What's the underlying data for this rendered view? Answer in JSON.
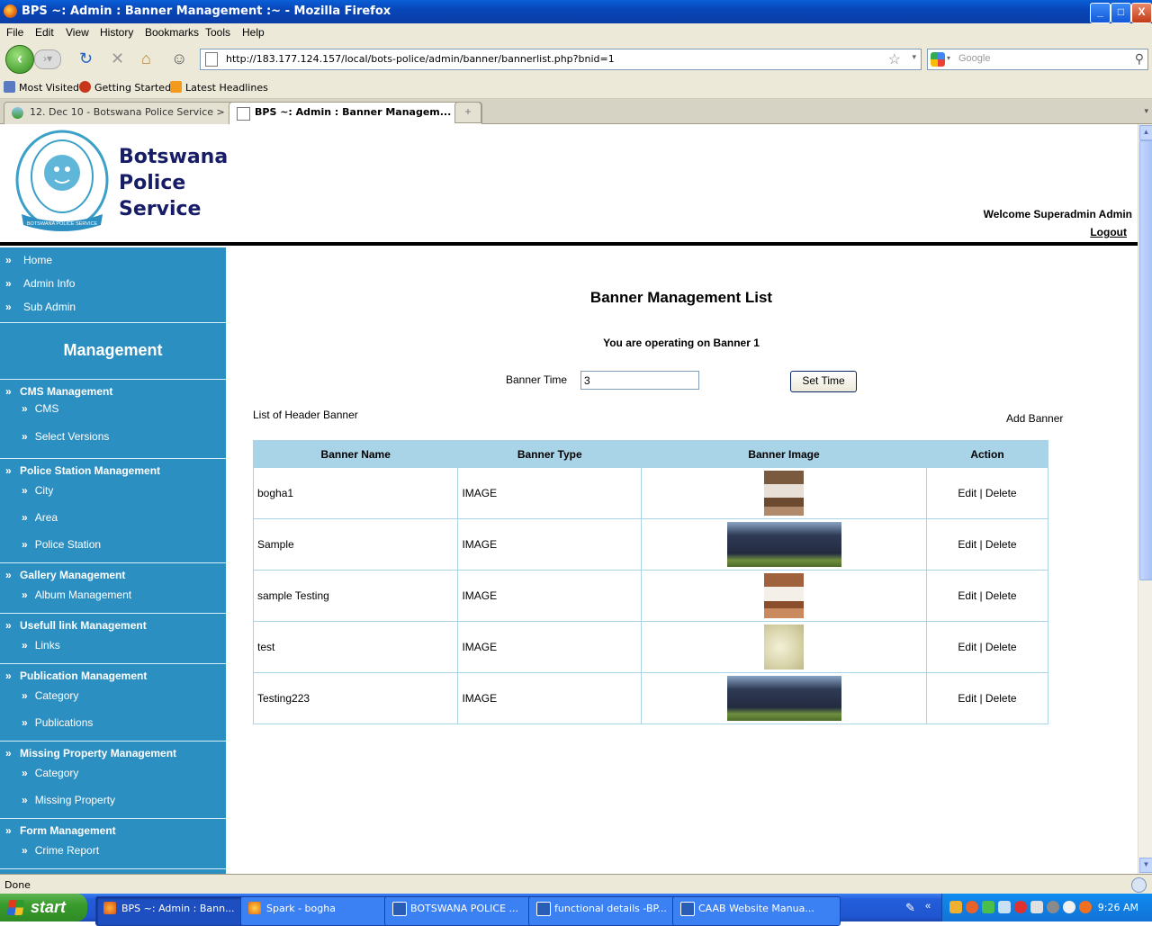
{
  "window": {
    "title": "BPS ~: Admin : Banner Management :~ - Mozilla Firefox",
    "buttons": {
      "minimize": "_",
      "maximize": "□",
      "close": "X"
    }
  },
  "menu": [
    "File",
    "Edit",
    "View",
    "History",
    "Bookmarks",
    "Tools",
    "Help"
  ],
  "toolbar": {
    "url": "http://183.177.124.157/local/bots-police/admin/banner/bannerlist.php?bnid=1",
    "search_placeholder": "Google"
  },
  "bookmarks": [
    "Most Visited",
    "Getting Started",
    "Latest Headlines"
  ],
  "tabs": [
    {
      "label": "12. Dec 10 - Botswana Police Service > ...",
      "active": false
    },
    {
      "label": "BPS ~: Admin : Banner Managem...",
      "active": true
    }
  ],
  "header": {
    "brand_line1": "Botswana",
    "brand_line2": "Police",
    "brand_line3": "Service",
    "logo_text": "BOTSWANA POLICE SERVICE",
    "welcome": "Welcome Superadmin Admin",
    "logout": "Logout"
  },
  "sidebar": {
    "top_items": [
      "Home",
      "Admin Info",
      "Sub Admin"
    ],
    "management_title": "Management",
    "chevron": "»",
    "sections": [
      {
        "title": "CMS Management",
        "items": [
          "CMS",
          "Select Versions"
        ]
      },
      {
        "title": "Police Station Management",
        "items": [
          "City",
          "Area",
          "Police Station"
        ]
      },
      {
        "title": "Gallery Management",
        "items": [
          "Album Management"
        ]
      },
      {
        "title": "Usefull link Management",
        "items": [
          "Links"
        ]
      },
      {
        "title": "Publication Management",
        "items": [
          "Category",
          "Publications"
        ]
      },
      {
        "title": "Missing Property Management",
        "items": [
          "Category",
          "Missing Property"
        ]
      },
      {
        "title": "Form Management",
        "items": [
          "Crime Report"
        ]
      }
    ]
  },
  "main": {
    "title": "Banner Management List",
    "operating": "You are operating on Banner 1",
    "banner_time_label": "Banner Time",
    "banner_time_value": "3",
    "set_time_button": "Set Time",
    "list_label": "List of Header Banner",
    "add_banner": "Add Banner",
    "columns": [
      "Banner Name",
      "Banner Type",
      "Banner Image",
      "Action"
    ],
    "rows": [
      {
        "name": "bogha1",
        "type": "IMAGE",
        "image": "bed-brown",
        "edit": "Edit",
        "sep": "|",
        "delete": "Delete"
      },
      {
        "name": "Sample",
        "type": "IMAGE",
        "image": "police-parade",
        "edit": "Edit",
        "sep": "|",
        "delete": "Delete"
      },
      {
        "name": "sample Testing",
        "type": "IMAGE",
        "image": "bed-white",
        "edit": "Edit",
        "sep": "|",
        "delete": "Delete"
      },
      {
        "name": "test",
        "type": "IMAGE",
        "image": "foam",
        "edit": "Edit",
        "sep": "|",
        "delete": "Delete"
      },
      {
        "name": "Testing223",
        "type": "IMAGE",
        "image": "police-parade",
        "edit": "Edit",
        "sep": "|",
        "delete": "Delete"
      }
    ]
  },
  "statusbar": {
    "text": "Done"
  },
  "taskbar": {
    "start": "start",
    "tasks": [
      {
        "label": "BPS ~: Admin : Bann...",
        "active": true
      },
      {
        "label": "Spark - bogha",
        "active": false
      },
      {
        "label": "BOTSWANA POLICE ...",
        "active": false
      },
      {
        "label": "functional details -BP...",
        "active": false
      },
      {
        "label": "CAAB Website Manua...",
        "active": false
      }
    ],
    "clock": "9:26 AM"
  }
}
